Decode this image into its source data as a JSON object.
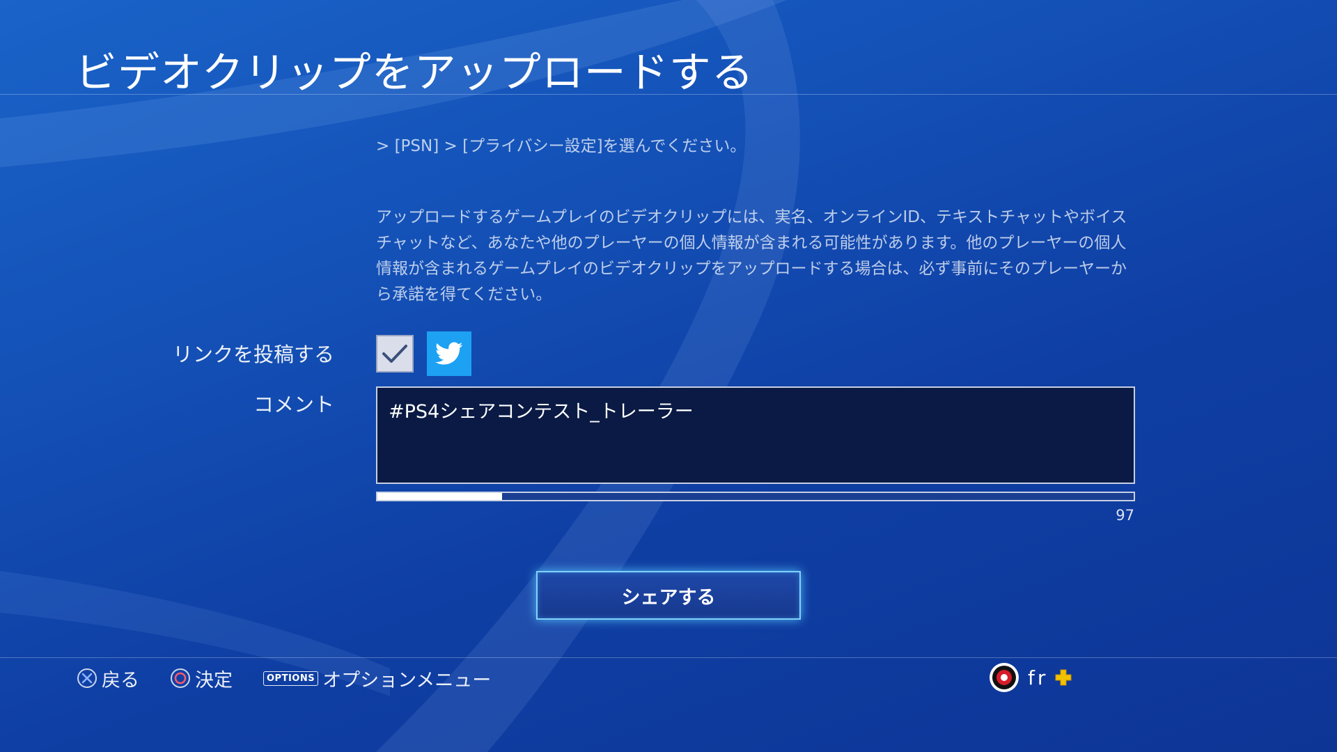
{
  "header": {
    "title": "ビデオクリップをアップロードする"
  },
  "body": {
    "privacy_text": "> [PSN] > [プライバシー設定]を選んでください。",
    "warning_text": "アップロードするゲームプレイのビデオクリップには、実名、オンラインID、テキストチャットやボイスチャットなど、あなたや他のプレーヤーの個人情報が含まれる可能性があります。他のプレーヤーの個人情報が含まれるゲームプレイのビデオクリップをアップロードする場合は、必ず事前にそのプレーヤーから承諾を得てください。"
  },
  "form": {
    "link_label": "リンクを投稿する",
    "comment_label": "コメント",
    "comment_value": "#PS4シェアコンテスト_トレーラー",
    "link_checked": true,
    "services": [
      {
        "icon": "twitter-icon",
        "color": "#1da1f2"
      }
    ],
    "progress_fraction": 0.165,
    "char_count": "97"
  },
  "share_button": {
    "label": "シェアする"
  },
  "footer": {
    "hints": [
      {
        "icon": "cross-button-icon",
        "label": "戻る"
      },
      {
        "icon": "circle-button-icon",
        "label": "決定"
      },
      {
        "icon": "options-button-icon",
        "key_label": "OPTIONS",
        "label": "オプションメニュー"
      }
    ],
    "user": {
      "name": "fr",
      "avatar_icon": "avatar-icon",
      "plus_icon": "playstation-plus-icon"
    }
  },
  "colors": {
    "background": "#1452b8",
    "accent_glow": "#7fd3ff",
    "twitter": "#1da1f2",
    "plus": "#f2c200"
  }
}
